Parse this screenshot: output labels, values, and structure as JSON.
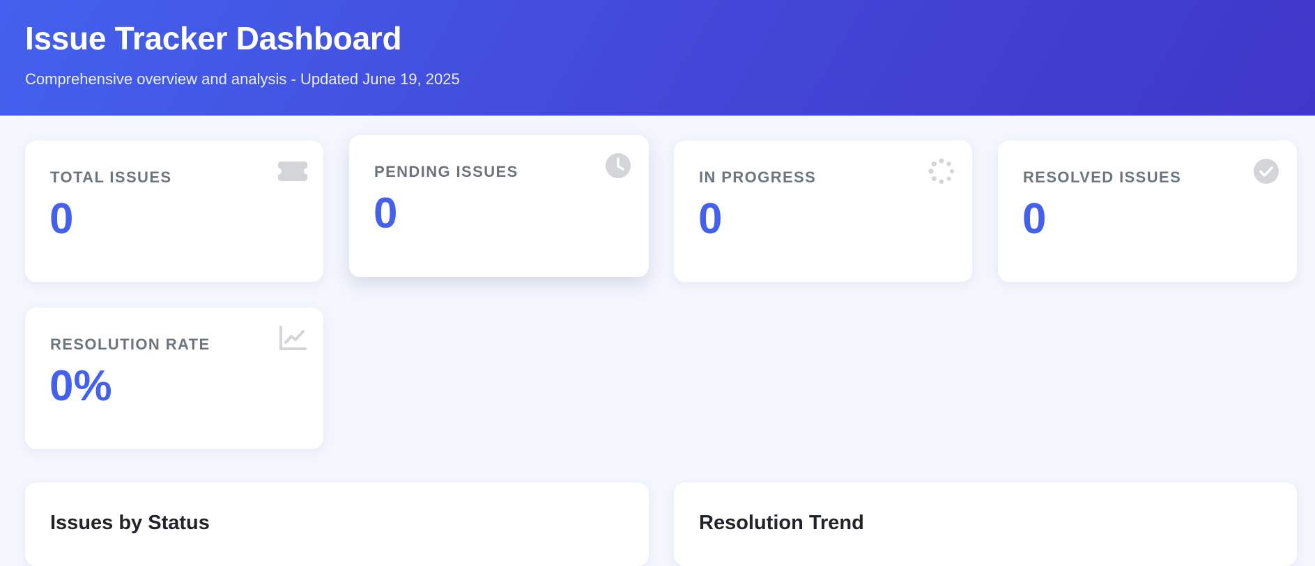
{
  "header": {
    "title": "Issue Tracker Dashboard",
    "subtitle": "Comprehensive overview and analysis - Updated June 19, 2025"
  },
  "stats": [
    {
      "label": "TOTAL ISSUES",
      "value": "0",
      "icon": "ticket-icon"
    },
    {
      "label": "PENDING ISSUES",
      "value": "0",
      "icon": "clock-icon"
    },
    {
      "label": "IN PROGRESS",
      "value": "0",
      "icon": "spinner-icon"
    },
    {
      "label": "RESOLVED ISSUES",
      "value": "0",
      "icon": "check-circle-icon"
    },
    {
      "label": "RESOLUTION RATE",
      "value": "0%",
      "icon": "chart-line-icon"
    }
  ],
  "panels": [
    {
      "title": "Issues by Status"
    },
    {
      "title": "Resolution Trend"
    }
  ],
  "colors": {
    "accent": "#4361ee",
    "header_start": "#4361ee",
    "header_end": "#3f37c9",
    "page_background": "#f3f6fd",
    "label_gray": "#6c757d",
    "icon_gray": "#d3d5d8"
  }
}
